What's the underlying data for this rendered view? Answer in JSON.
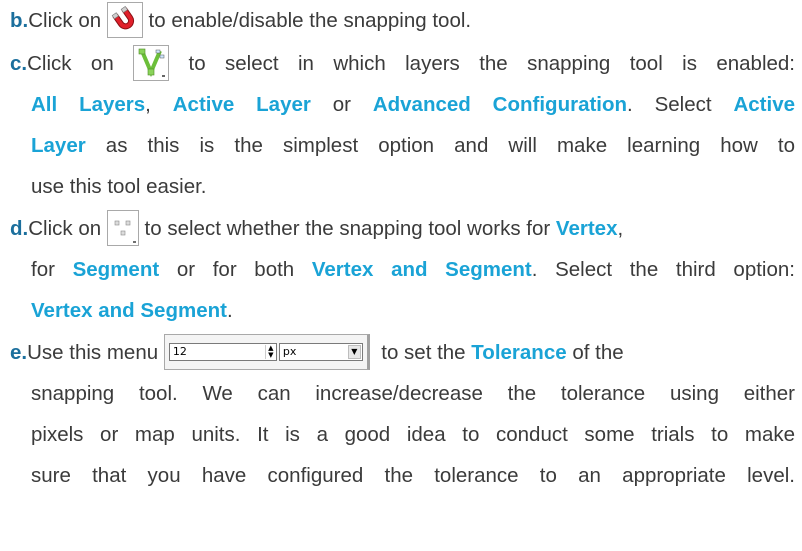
{
  "b": {
    "letter": "b.",
    "before": "Click on",
    "after": "to enable/disable the snapping tool.",
    "icon": "magnet-icon"
  },
  "c": {
    "letter": "c.",
    "before": "Click on",
    "after1": "to select in which layers the snapping tool is enabled:",
    "opt1": "All Layers",
    "sep1": ", ",
    "opt2": "Active Layer",
    "sep2": " or ",
    "opt3": "Advanced Configuration",
    "mid": ". Select ",
    "sel_a": "Active",
    "sel_b": "Layer",
    "after2": "as this is the simplest option and will make learning how to",
    "after3": "use this tool easier.",
    "icon": "snapping-layers-icon"
  },
  "d": {
    "letter": "d.",
    "before": "Click on",
    "after1": "to select whether the snapping tool works for",
    "opt1": "Vertex",
    "comma": ",",
    "for1": "for ",
    "opt2": "Segment",
    "mid": " or for both ",
    "opt3": "Vertex and Segment",
    "tail": ". Select the third option:",
    "sel": "Vertex and Segment",
    "end": ".",
    "icon": "snap-mode-icon"
  },
  "e": {
    "letter": "e.",
    "before": "Use this menu",
    "after1": "to set the",
    "term": "Tolerance",
    "after1b": "of the",
    "line2": "snapping tool. We can increase/decrease the tolerance using either",
    "line3": "pixels or map units. It is a good idea to conduct some trials to make",
    "line4": "sure that you have configured the tolerance to an appropriate level.",
    "tolerance_value": "12",
    "unit": "px"
  }
}
